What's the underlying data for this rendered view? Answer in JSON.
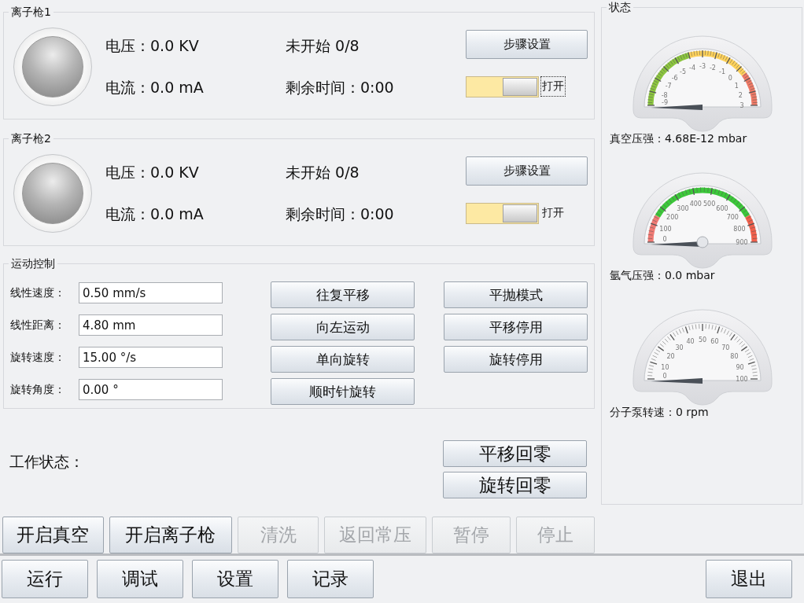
{
  "ion_guns": [
    {
      "title": "离子枪1",
      "lamp_on": false,
      "voltage": "电压：0.0 KV",
      "current": "电流：0.0 mA",
      "progress": "未开始 0/8",
      "remaining": "剩余时间：0:00",
      "steps_button": "步骤设置",
      "toggle_on": true,
      "toggle_label": "打开",
      "toggle_focused": true
    },
    {
      "title": "离子枪2",
      "lamp_on": false,
      "voltage": "电压：0.0 KV",
      "current": "电流：0.0 mA",
      "progress": "未开始 0/8",
      "remaining": "剩余时间：0:00",
      "steps_button": "步骤设置",
      "toggle_on": true,
      "toggle_label": "打开",
      "toggle_focused": false
    }
  ],
  "motion_control": {
    "title": "运动控制",
    "fields": [
      {
        "label": "线性速度：",
        "value": "0.50 mm/s"
      },
      {
        "label": "线性距离：",
        "value": "4.80 mm"
      },
      {
        "label": "旋转速度：",
        "value": "15.00 °/s"
      },
      {
        "label": "旋转角度：",
        "value": "0.00 °"
      }
    ],
    "buttons": [
      "往复平移",
      "向左运动",
      "单向旋转",
      "顺时针旋转"
    ],
    "buttons_right": [
      "平抛模式",
      "平移停用",
      "旋转停用"
    ]
  },
  "work_status": {
    "label": "工作状态：",
    "buttons": [
      "平移回零",
      "旋转回零"
    ]
  },
  "actions": [
    {
      "label": "开启真空",
      "disabled": false
    },
    {
      "label": "开启离子枪",
      "disabled": false
    },
    {
      "label": "清洗",
      "disabled": true
    },
    {
      "label": "返回常压",
      "disabled": true
    },
    {
      "label": "暂停",
      "disabled": true
    },
    {
      "label": "停止",
      "disabled": true
    }
  ],
  "nav": [
    "运行",
    "调试",
    "设置",
    "记录"
  ],
  "exit_button": "退出",
  "status": {
    "title": "状态",
    "gauges": [
      {
        "kind": "vacuum",
        "scale": [
          "-9",
          "-8",
          "-7",
          "-6",
          "-5",
          "-4",
          "-3",
          "-2",
          "-1",
          "0",
          "1",
          "2",
          "3"
        ],
        "reading": "真空压强：4.68E-12 mbar"
      },
      {
        "kind": "argon",
        "scale": [
          "0",
          "100",
          "200",
          "300",
          "400",
          "500",
          "600",
          "700",
          "800",
          "900"
        ],
        "reading": "氩气压强：0.0 mbar"
      },
      {
        "kind": "speed",
        "scale": [
          "0",
          "10",
          "20",
          "30",
          "40",
          "50",
          "60",
          "70",
          "80",
          "90",
          "100"
        ],
        "reading": "分子泵转速：0 rpm"
      }
    ]
  }
}
